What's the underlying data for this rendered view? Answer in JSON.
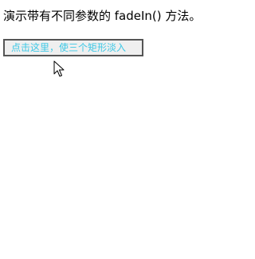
{
  "intro_text": "演示带有不同参数的 fadeIn() 方法。",
  "button_label": "点击这里，使三个矩形淡入",
  "colors": {
    "button_text": "#3ec8e6",
    "button_bg": "#efefef",
    "button_border": "#555555"
  },
  "cursor_icon": "arrow-cursor-icon"
}
